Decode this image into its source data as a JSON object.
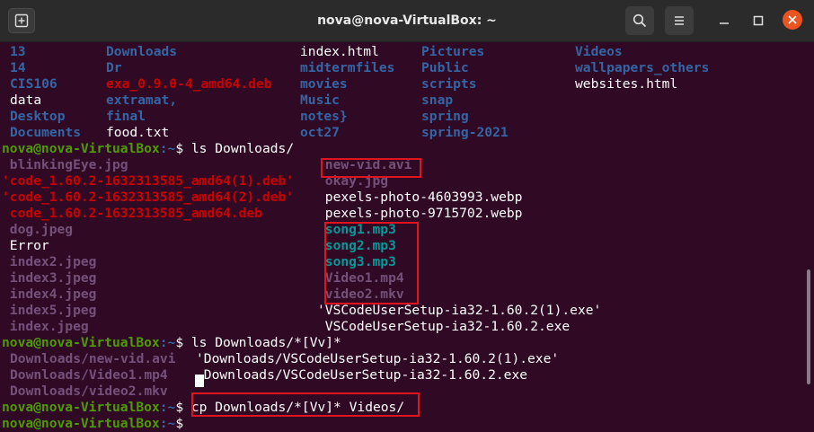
{
  "window": {
    "title": "nova@nova-VirtualBox: ~"
  },
  "prompt": {
    "user_host": "nova@nova-VirtualBox",
    "path": ":~",
    "symbol": "$"
  },
  "listing_home": [
    {
      "text": "13",
      "color": "blue",
      "col": 0,
      "row": 0
    },
    {
      "text": "Downloads",
      "color": "blue",
      "col": 1,
      "row": 0
    },
    {
      "text": "index.html",
      "color": "white",
      "col": 2,
      "row": 0
    },
    {
      "text": "Pictures",
      "color": "blue",
      "col": 3,
      "row": 0
    },
    {
      "text": "Videos",
      "color": "blue",
      "col": 4,
      "row": 0
    },
    {
      "text": "14",
      "color": "blue",
      "col": 0,
      "row": 1
    },
    {
      "text": "Dr",
      "color": "blue",
      "col": 1,
      "row": 1
    },
    {
      "text": "midtermfiles",
      "color": "blue",
      "col": 2,
      "row": 1
    },
    {
      "text": "Public",
      "color": "blue",
      "col": 3,
      "row": 1
    },
    {
      "text": "wallpapers_others",
      "color": "blue",
      "col": 4,
      "row": 1
    },
    {
      "text": "CIS106",
      "color": "blue",
      "col": 0,
      "row": 2
    },
    {
      "text": "exa_0.9.0-4_amd64.deb",
      "color": "red",
      "col": 1,
      "row": 2
    },
    {
      "text": "movies",
      "color": "blue",
      "col": 2,
      "row": 2
    },
    {
      "text": "scripts",
      "color": "blue",
      "col": 3,
      "row": 2
    },
    {
      "text": "websites.html",
      "color": "white",
      "col": 4,
      "row": 2
    },
    {
      "text": "data",
      "color": "white",
      "col": 0,
      "row": 3
    },
    {
      "text": "extramat,",
      "color": "blue",
      "col": 1,
      "row": 3
    },
    {
      "text": "Music",
      "color": "blue",
      "col": 2,
      "row": 3
    },
    {
      "text": "snap",
      "color": "blue",
      "col": 3,
      "row": 3
    },
    {
      "text": "Desktop",
      "color": "blue",
      "col": 0,
      "row": 4
    },
    {
      "text": "final",
      "color": "blue",
      "col": 1,
      "row": 4
    },
    {
      "text": "notes}",
      "color": "blue",
      "col": 2,
      "row": 4
    },
    {
      "text": "spring",
      "color": "blue",
      "col": 3,
      "row": 4
    },
    {
      "text": "Documents",
      "color": "blue",
      "col": 0,
      "row": 5
    },
    {
      "text": "food.txt",
      "color": "white",
      "col": 1,
      "row": 5
    },
    {
      "text": "oct27",
      "color": "blue",
      "col": 2,
      "row": 5
    },
    {
      "text": "spring-2021",
      "color": "blue",
      "col": 3,
      "row": 5
    }
  ],
  "cmd1": "ls Downloads/",
  "listing_downloads": [
    {
      "text": " blinkingEye.jpg",
      "color": "mag",
      "col": 0,
      "row": 0
    },
    {
      "text": "'code_1.60.2-1632313585_amd64(1).deb'",
      "color": "red",
      "col": 0,
      "row": 1
    },
    {
      "text": "'code_1.60.2-1632313585_amd64(2).deb'",
      "color": "red",
      "col": 0,
      "row": 2
    },
    {
      "text": " code_1.60.2-1632313585_amd64.deb",
      "color": "red",
      "col": 0,
      "row": 3
    },
    {
      "text": " dog.jpeg",
      "color": "mag",
      "col": 0,
      "row": 4
    },
    {
      "text": " Error",
      "color": "white",
      "col": 0,
      "row": 5
    },
    {
      "text": " index2.jpeg",
      "color": "mag",
      "col": 0,
      "row": 6
    },
    {
      "text": " index3.jpeg",
      "color": "mag",
      "col": 0,
      "row": 7
    },
    {
      "text": " index4.jpeg",
      "color": "mag",
      "col": 0,
      "row": 8
    },
    {
      "text": " index5.jpeg",
      "color": "mag",
      "col": 0,
      "row": 9
    },
    {
      "text": " index.jpeg",
      "color": "mag",
      "col": 0,
      "row": 10
    },
    {
      "text": " new-vid.avi",
      "color": "mag",
      "col": 1,
      "row": 0
    },
    {
      "text": " okay.jpg",
      "color": "mag",
      "col": 1,
      "row": 1
    },
    {
      "text": " pexels-photo-4603993.webp",
      "color": "white",
      "col": 1,
      "row": 2
    },
    {
      "text": " pexels-photo-9715702.webp",
      "color": "white",
      "col": 1,
      "row": 3
    },
    {
      "text": " song1.mp3",
      "color": "cyan",
      "col": 1,
      "row": 4
    },
    {
      "text": " song2.mp3",
      "color": "cyan",
      "col": 1,
      "row": 5
    },
    {
      "text": " song3.mp3",
      "color": "cyan",
      "col": 1,
      "row": 6
    },
    {
      "text": " Video1.mp4",
      "color": "mag",
      "col": 1,
      "row": 7
    },
    {
      "text": " video2.mkv",
      "color": "mag",
      "col": 1,
      "row": 8
    },
    {
      "text": "'VSCodeUserSetup-ia32-1.60.2(1).exe'",
      "color": "white",
      "col": 1,
      "row": 9
    },
    {
      "text": " VSCodeUserSetup-ia32-1.60.2.exe",
      "color": "white",
      "col": 1,
      "row": 10
    }
  ],
  "cmd2": "ls Downloads/*[Vv]*",
  "listing_glob": [
    {
      "text": "Downloads/new-vid.avi",
      "color": "mag",
      "col": 0,
      "row": 0
    },
    {
      "text": "Downloads/Video1.mp4",
      "color": "mag",
      "col": 0,
      "row": 1
    },
    {
      "text": "Downloads/video2.mkv",
      "color": "mag",
      "col": 0,
      "row": 2
    },
    {
      "text": "'Downloads/VSCodeUserSetup-ia32-1.60.2(1).exe'",
      "color": "white",
      "col": 1,
      "row": 0
    },
    {
      "text": " Downloads/VSCodeUserSetup-ia32-1.60.2.exe",
      "color": "white",
      "col": 1,
      "row": 1
    }
  ],
  "cmd3": "cp Downloads/*[Vv]* Videos/"
}
